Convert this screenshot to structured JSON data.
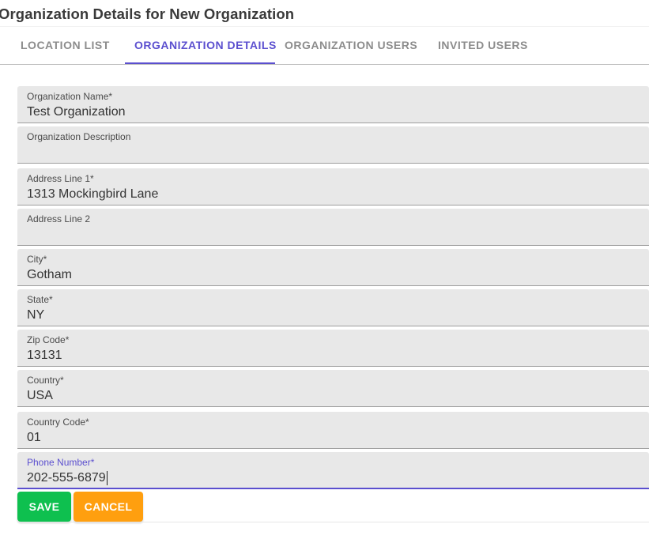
{
  "page": {
    "title": "Organization Details for New Organization"
  },
  "tabs": [
    {
      "label": "LOCATION LIST",
      "active": false
    },
    {
      "label": "ORGANIZATION DETAILS",
      "active": true
    },
    {
      "label": "ORGANIZATION USERS",
      "active": false
    },
    {
      "label": "INVITED USERS",
      "active": false
    }
  ],
  "form": {
    "fields": [
      {
        "label": "Organization Name*",
        "value": "Test Organization"
      },
      {
        "label": "Organization Description",
        "value": ""
      },
      {
        "label": "Address Line 1*",
        "value": "1313 Mockingbird Lane"
      },
      {
        "label": "Address Line 2",
        "value": ""
      },
      {
        "label": "City*",
        "value": "Gotham"
      },
      {
        "label": "State*",
        "value": "NY"
      },
      {
        "label": "Zip Code*",
        "value": "13131"
      },
      {
        "label": "Country*",
        "value": "USA"
      },
      {
        "label": "Country Code*",
        "value": "01"
      },
      {
        "label": "Phone Number*",
        "value": "202-555-6879",
        "focused": true
      }
    ]
  },
  "actions": {
    "save_label": "SAVE",
    "cancel_label": "CANCEL"
  },
  "colors": {
    "accent": "#5b4fcf",
    "save": "#0ec04f",
    "cancel": "#ff9f0f",
    "field_background": "#e8e8e8"
  }
}
